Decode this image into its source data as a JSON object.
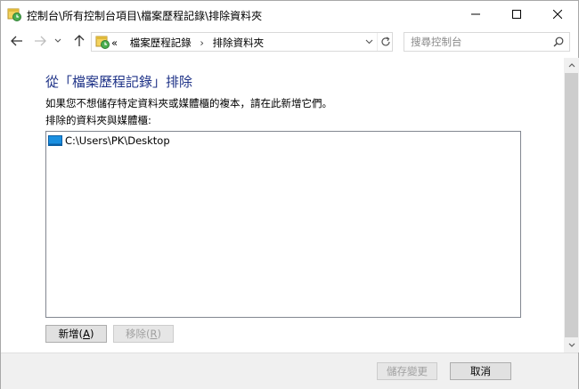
{
  "window": {
    "title": "控制台\\所有控制台項目\\檔案歷程記錄\\排除資料夾"
  },
  "address": {
    "overflow": "«",
    "crumbs": [
      "檔案歷程記錄",
      "排除資料夾"
    ],
    "separator": "›"
  },
  "search": {
    "placeholder": "搜尋控制台"
  },
  "main": {
    "title": "從「檔案歷程記錄」排除",
    "description": "如果您不想儲存特定資料夾或媒體櫃的複本，請在此新增它們。",
    "list_label": "排除的資料夾與媒體櫃:",
    "items": [
      "C:\\Users\\PK\\Desktop"
    ],
    "add_button": {
      "label": "新增(",
      "key": "A",
      "suffix": ")"
    },
    "remove_button": {
      "label": "移除(",
      "key": "R",
      "suffix": ")"
    }
  },
  "footer": {
    "save_label": "儲存變更",
    "cancel_label": "取消"
  },
  "colors": {
    "title_blue": "#1e3287",
    "disabled_text": "#a0a0a0"
  }
}
